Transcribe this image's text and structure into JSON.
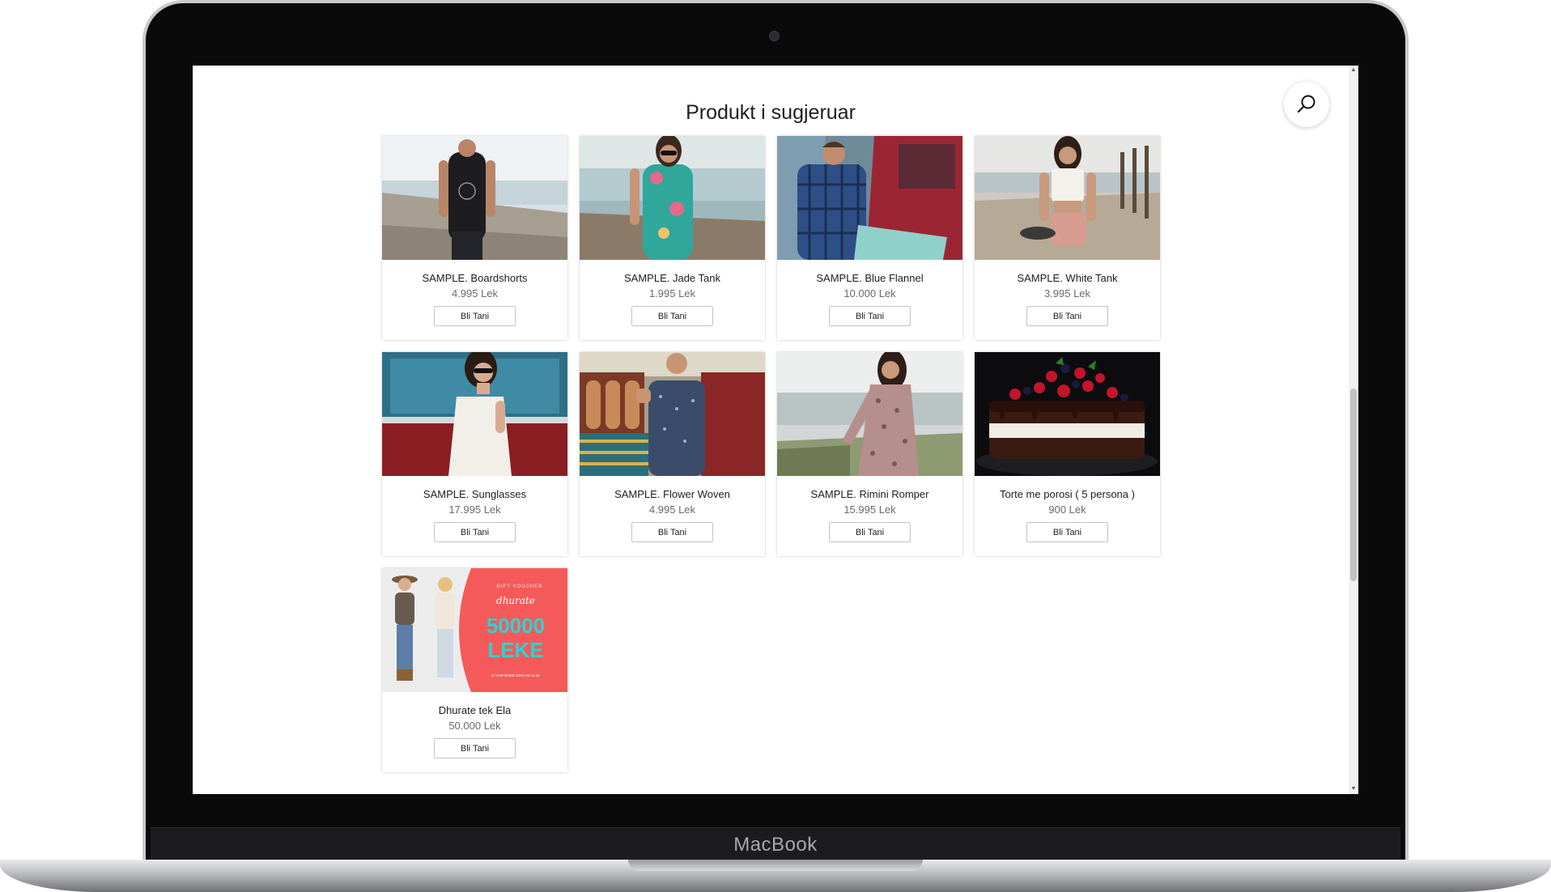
{
  "page": {
    "title": "Produkt i sugjeruar"
  },
  "device": {
    "brand": "MacBook"
  },
  "products": [
    {
      "name": "SAMPLE. Boardshorts",
      "price": "4.995 Lek",
      "button": "Bli Tani",
      "image": "boardshorts-photo"
    },
    {
      "name": "SAMPLE. Jade Tank",
      "price": "1.995 Lek",
      "button": "Bli Tani",
      "image": "jade-tank-photo"
    },
    {
      "name": "SAMPLE. Blue Flannel",
      "price": "10.000 Lek",
      "button": "Bli Tani",
      "image": "blue-flannel-photo"
    },
    {
      "name": "SAMPLE. White Tank",
      "price": "3.995 Lek",
      "button": "Bli Tani",
      "image": "white-tank-photo"
    },
    {
      "name": "SAMPLE. Sunglasses",
      "price": "17.995 Lek",
      "button": "Bli Tani",
      "image": "sunglasses-photo"
    },
    {
      "name": "SAMPLE. Flower Woven",
      "price": "4.995 Lek",
      "button": "Bli Tani",
      "image": "flower-woven-photo"
    },
    {
      "name": "SAMPLE. Rimini Romper",
      "price": "15.995 Lek",
      "button": "Bli Tani",
      "image": "rimini-romper-photo"
    },
    {
      "name": "Torte me porosi ( 5 persona )",
      "price": "900 Lek",
      "button": "Bli Tani",
      "image": "cake-photo"
    },
    {
      "name": "Dhurate tek Ela",
      "price": "50.000 Lek",
      "button": "Bli Tani",
      "image": "gift-card-photo"
    }
  ],
  "gift_card": {
    "line1": "dhurate",
    "line2": "50000",
    "line3": "LEKE"
  },
  "colors": {
    "gift_card_bg": "#f55a5a",
    "gift_card_text": "#2ad4d4",
    "scroll_thumb": "#c1c1c1"
  }
}
